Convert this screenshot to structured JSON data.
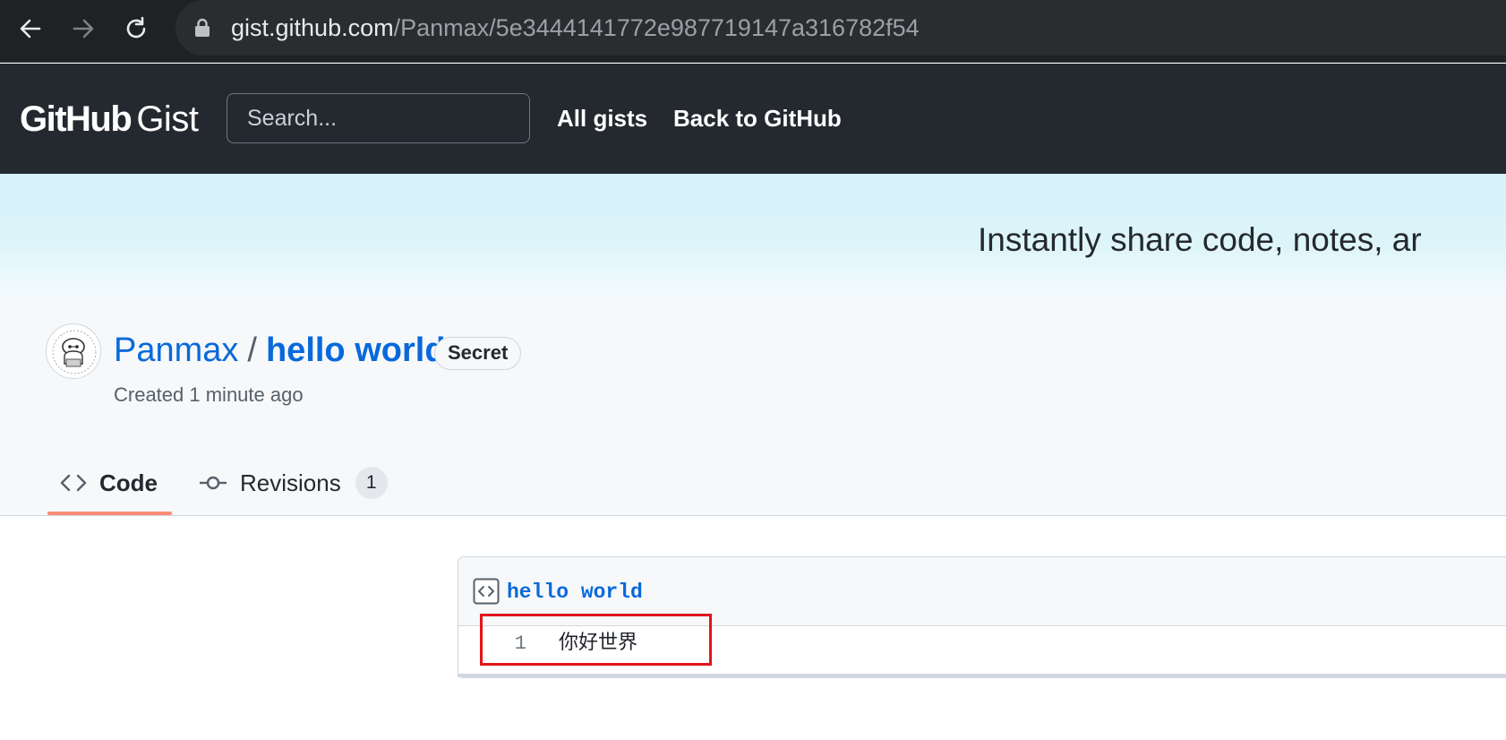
{
  "browser": {
    "url_host": "gist.github.com",
    "url_path": "/Panmax/5e3444141772e987719147a316782f54"
  },
  "header": {
    "logo_github": "GitHub",
    "logo_gist": "Gist",
    "search_placeholder": "Search...",
    "links": {
      "all_gists": "All gists",
      "back_to_github": "Back to GitHub"
    }
  },
  "hero": {
    "tagline": "Instantly share code, notes, ar"
  },
  "gist": {
    "owner": "Panmax",
    "separator": "/",
    "name": "hello world",
    "visibility_badge": "Secret",
    "created": "Created 1 minute ago"
  },
  "tabs": [
    {
      "label": "Code",
      "icon": "code-icon",
      "selected": true
    },
    {
      "label": "Revisions",
      "icon": "git-commit-icon",
      "count": "1"
    }
  ],
  "file": {
    "name": "hello world",
    "icon": "file-code-icon",
    "lines": [
      {
        "number": "1",
        "content": "你好世界"
      }
    ]
  },
  "colors": {
    "header_bg": "#24292f",
    "link": "#0969da",
    "tab_underline": "#fd8c73",
    "annotation": "#e3141b"
  }
}
